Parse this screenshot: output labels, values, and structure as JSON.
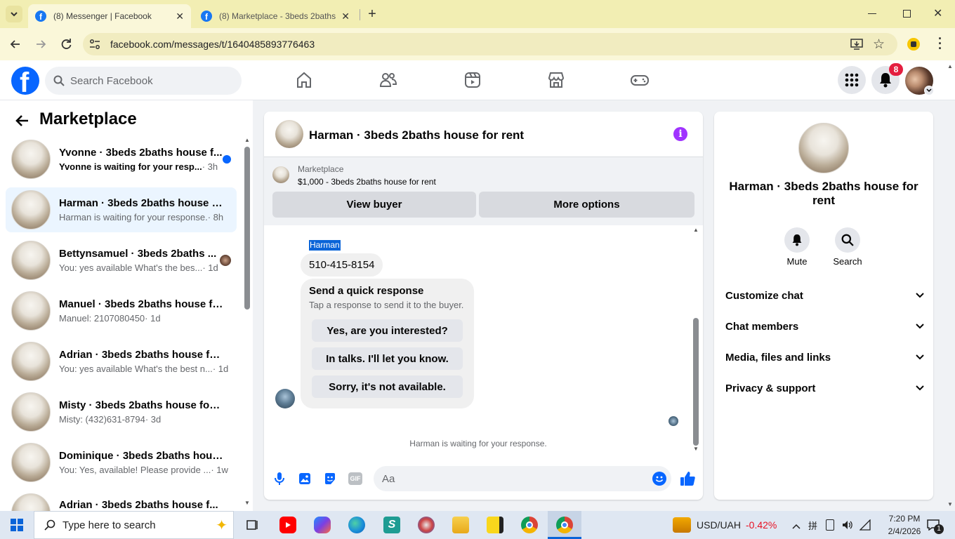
{
  "browser": {
    "tabs": [
      {
        "title": "(8) Messenger | Facebook",
        "active": true
      },
      {
        "title": "(8) Marketplace - 3beds 2baths",
        "active": false
      }
    ],
    "url": "facebook.com/messages/t/1640485893776463"
  },
  "facebook": {
    "search_placeholder": "Search Facebook",
    "notification_count": "8",
    "logo_letter": "f"
  },
  "sidebar": {
    "title": "Marketplace",
    "conversations": [
      {
        "name": "Yvonne · 3beds 2baths house f...",
        "snippet": "Yvonne is waiting for your resp...",
        "time": "· 3h",
        "unread": true
      },
      {
        "name": "Harman · 3beds 2baths house fo...",
        "snippet": "Harman is waiting for your response.",
        "time": "· 8h",
        "selected": true
      },
      {
        "name": "Bettynsamuel · 3beds 2baths ...",
        "snippet": "You: yes available What's the bes...",
        "time": "· 1d"
      },
      {
        "name": "Manuel · 3beds 2baths house fo...",
        "snippet": "Manuel: 2107080450",
        "time": "· 1d"
      },
      {
        "name": "Adrian · 3beds 2baths house for ...",
        "snippet": "You: yes available What's the best n...",
        "time": "· 1d"
      },
      {
        "name": "Misty · 3beds 2baths house for r...",
        "snippet": "Misty: (432)631-8794",
        "time": "· 3d"
      },
      {
        "name": "Dominique · 3beds 2baths hous...",
        "snippet": "You: Yes, available! Please provide ...",
        "time": "· 1w"
      },
      {
        "name": "Adrian · 3beds 2baths house f...",
        "snippet": "",
        "time": ""
      }
    ]
  },
  "chat": {
    "title": "Harman · 3beds 2baths house for rent",
    "listing_source": "Marketplace",
    "listing_text": "$1,000 - 3beds 2baths house for rent",
    "view_buyer": "View buyer",
    "more_options": "More options",
    "sender_name": "Harman",
    "message": "510-415-8154",
    "quick_response_title": "Send a quick response",
    "quick_response_sub": "Tap a response to send it to the buyer.",
    "quick_responses": [
      "Yes, are you interested?",
      "In talks. I'll let you know.",
      "Sorry, it's not available."
    ],
    "waiting_text": "Harman is waiting for your response.",
    "composer_placeholder": "Aa",
    "gif_label": "GIF"
  },
  "details": {
    "name": "Harman · 3beds 2baths house for rent",
    "mute_label": "Mute",
    "search_label": "Search",
    "sections": [
      "Customize chat",
      "Chat members",
      "Media, files and links",
      "Privacy & support"
    ]
  },
  "taskbar": {
    "search_placeholder": "Type here to search",
    "currency": "USD/UAH",
    "currency_change": "-0.42%",
    "time": "7:20 PM",
    "date": "2/4/2026",
    "notif_count": "1"
  },
  "colors": {
    "brand": "#1877f2",
    "accent": "#0866ff",
    "info": "#a033ff",
    "badge": "#e41e3f",
    "down": "#e81123"
  }
}
